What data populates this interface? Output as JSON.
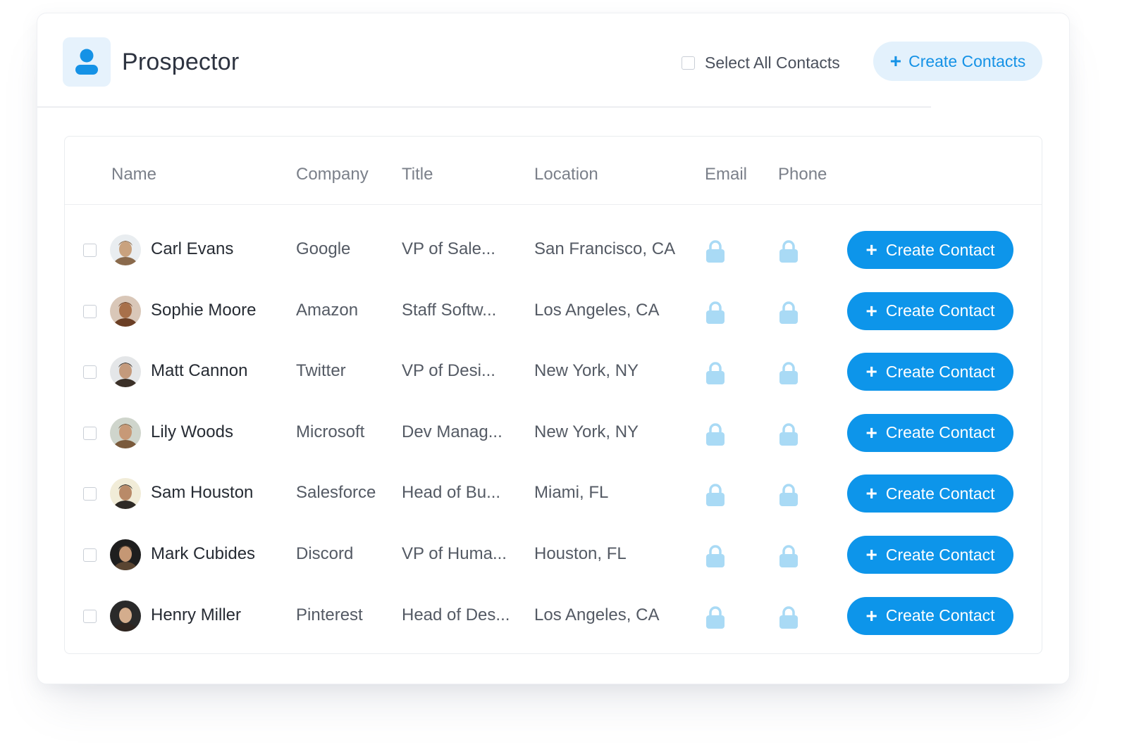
{
  "app": {
    "title": "Prospector",
    "icon": "user-icon",
    "accent_color": "#0d95ea",
    "accent_light": "#e3f1fc",
    "lock_color": "#a9daf5"
  },
  "header": {
    "select_all_label": "Select All Contacts",
    "select_all_checked": false,
    "create_contacts_label": "Create Contacts",
    "create_contacts_icon": "plus-icon"
  },
  "table": {
    "columns": [
      "Name",
      "Company",
      "Title",
      "Location",
      "Email",
      "Phone"
    ],
    "lock_icon": "lock-icon",
    "action_label": "Create Contact",
    "rows": [
      {
        "name": "Carl Evans",
        "company": "Google",
        "title": "VP of Sale...",
        "location": "San Francisco, CA",
        "checked": false
      },
      {
        "name": "Sophie Moore",
        "company": "Amazon",
        "title": "Staff Softw...",
        "location": "Los Angeles, CA",
        "checked": false
      },
      {
        "name": "Matt Cannon",
        "company": "Twitter",
        "title": "VP of Desi...",
        "location": "New York, NY",
        "checked": false
      },
      {
        "name": "Lily Woods",
        "company": "Microsoft",
        "title": "Dev Manag...",
        "location": "New York, NY",
        "checked": false
      },
      {
        "name": "Sam Houston",
        "company": "Salesforce",
        "title": "Head of Bu...",
        "location": "Miami, FL",
        "checked": false
      },
      {
        "name": "Mark Cubides",
        "company": "Discord",
        "title": "VP of Huma...",
        "location": "Houston, FL",
        "checked": false
      },
      {
        "name": "Henry Miller",
        "company": "Pinterest",
        "title": "Head of Des...",
        "location": "Los Angeles, CA",
        "checked": false
      }
    ]
  }
}
